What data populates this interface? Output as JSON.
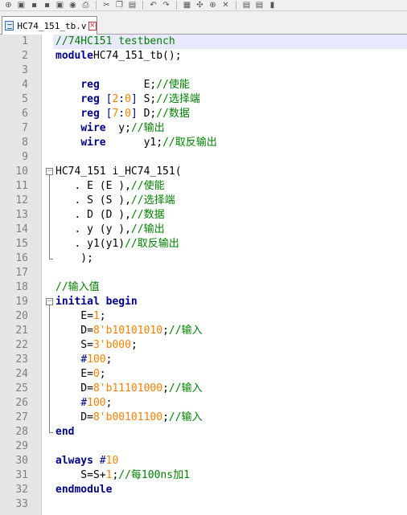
{
  "toolbar": {
    "icons": [
      "new-file-icon",
      "open-file-icon",
      "save-icon",
      "save-all-icon",
      "close-file-icon",
      "close-all-icon",
      "print-icon",
      "cut-icon",
      "copy-icon",
      "paste-icon",
      "undo-icon",
      "redo-icon",
      "find-icon",
      "replace-icon",
      "zoom-in-icon",
      "zoom-out-icon",
      "sync-scroll-icon",
      "wrap-icon",
      "indent-guide-icon"
    ],
    "glyphs": [
      "⊕",
      "▣",
      "▪",
      "▪",
      "▣",
      "◉",
      "⎙",
      "✂",
      "❐",
      "▤",
      "↶",
      "↷",
      "▦",
      "✣",
      "⊕",
      "✕",
      "▤",
      "▤",
      "▮"
    ]
  },
  "tab": {
    "label": "HC74_151_tb.v",
    "close_glyph": "×"
  },
  "editor": {
    "line_numbers": [
      "1",
      "2",
      "3",
      "4",
      "5",
      "6",
      "7",
      "8",
      "9",
      "10",
      "11",
      "12",
      "13",
      "14",
      "15",
      "16",
      "17",
      "18",
      "19",
      "20",
      "21",
      "22",
      "23",
      "24",
      "25",
      "26",
      "27",
      "28",
      "29",
      "30",
      "31",
      "32",
      "33"
    ],
    "lines": [
      [
        [
          "cm",
          "//74HC151 testbench"
        ]
      ],
      [
        [
          "kw",
          "module"
        ],
        [
          "",
          "HC74_151_tb();"
        ]
      ],
      [],
      [
        [
          "",
          "    "
        ],
        [
          "kw",
          "reg"
        ],
        [
          "",
          "       E;"
        ],
        [
          "cm",
          "//使能"
        ]
      ],
      [
        [
          "",
          "    "
        ],
        [
          "kw",
          "reg"
        ],
        [
          "op",
          " ["
        ],
        [
          "num",
          "2"
        ],
        [
          "op",
          ":"
        ],
        [
          "num",
          "0"
        ],
        [
          "op",
          "]"
        ],
        [
          "",
          " S;"
        ],
        [
          "cm",
          "//选择端"
        ]
      ],
      [
        [
          "",
          "    "
        ],
        [
          "kw",
          "reg"
        ],
        [
          "op",
          " ["
        ],
        [
          "num",
          "7"
        ],
        [
          "op",
          ":"
        ],
        [
          "num",
          "0"
        ],
        [
          "op",
          "]"
        ],
        [
          "",
          " D;"
        ],
        [
          "cm",
          "//数据"
        ]
      ],
      [
        [
          "",
          "    "
        ],
        [
          "kw",
          "wire"
        ],
        [
          "",
          "  y;"
        ],
        [
          "cm",
          "//输出"
        ]
      ],
      [
        [
          "",
          "    "
        ],
        [
          "kw",
          "wire"
        ],
        [
          "",
          "      y1;"
        ],
        [
          "cm",
          "//取反输出"
        ]
      ],
      [],
      [
        [
          "",
          "HC74_151 i_HC74_151("
        ]
      ],
      [
        [
          "",
          "   . E (E ),"
        ],
        [
          "cm",
          "//使能"
        ]
      ],
      [
        [
          "",
          "   . S (S ),"
        ],
        [
          "cm",
          "//选择端"
        ]
      ],
      [
        [
          "",
          "   . D (D ),"
        ],
        [
          "cm",
          "//数据"
        ]
      ],
      [
        [
          "",
          "   . y (y ),"
        ],
        [
          "cm",
          "//输出"
        ]
      ],
      [
        [
          "",
          "   . y1(y1)"
        ],
        [
          "cm",
          "//取反输出"
        ]
      ],
      [
        [
          "",
          "    );"
        ]
      ],
      [],
      [
        [
          "cm",
          "//输入值"
        ]
      ],
      [
        [
          "kw",
          "initial"
        ],
        [
          "",
          " "
        ],
        [
          "kw",
          "begin"
        ]
      ],
      [
        [
          "",
          "    E="
        ],
        [
          "num",
          "1"
        ],
        [
          "",
          ";"
        ]
      ],
      [
        [
          "",
          "    D="
        ],
        [
          "num",
          "8'b10101010"
        ],
        [
          "",
          ";"
        ],
        [
          "cm",
          "//输入"
        ]
      ],
      [
        [
          "",
          "    S="
        ],
        [
          "num",
          "3'b000"
        ],
        [
          "",
          ";"
        ]
      ],
      [
        [
          "",
          "    "
        ],
        [
          "op",
          "#"
        ],
        [
          "num",
          "100"
        ],
        [
          "",
          ";"
        ]
      ],
      [
        [
          "",
          "    E="
        ],
        [
          "num",
          "0"
        ],
        [
          "",
          ";"
        ]
      ],
      [
        [
          "",
          "    D="
        ],
        [
          "num",
          "8'b11101000"
        ],
        [
          "",
          ";"
        ],
        [
          "cm",
          "//输入"
        ]
      ],
      [
        [
          "",
          "    "
        ],
        [
          "op",
          "#"
        ],
        [
          "num",
          "100"
        ],
        [
          "",
          ";"
        ]
      ],
      [
        [
          "",
          "    D="
        ],
        [
          "num",
          "8'b00101100"
        ],
        [
          "",
          ";"
        ],
        [
          "cm",
          "//输入"
        ]
      ],
      [
        [
          "kw",
          "end"
        ]
      ],
      [],
      [
        [
          "kw",
          "always"
        ],
        [
          "",
          " "
        ],
        [
          "op",
          "#"
        ],
        [
          "num",
          "10"
        ]
      ],
      [
        [
          "",
          "    S=S+"
        ],
        [
          "num",
          "1"
        ],
        [
          "",
          ";"
        ],
        [
          "cm",
          "//每100ns加1"
        ]
      ],
      [
        [
          "kw",
          "endmodule"
        ]
      ],
      []
    ]
  },
  "colors": {
    "keyword": "#00008b",
    "comment": "#008000",
    "number": "#ff8000",
    "operator": "#000080",
    "gutter_bg": "#e6e6e6",
    "current_line": "#e8e8ff"
  }
}
